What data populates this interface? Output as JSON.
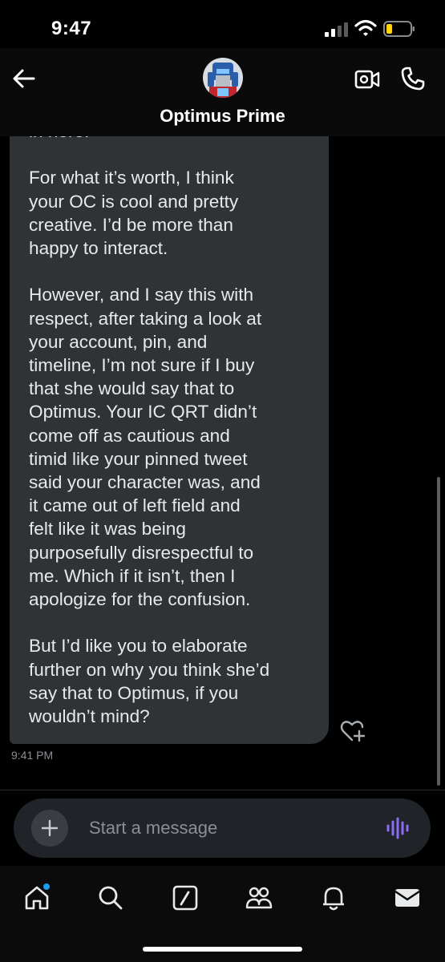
{
  "status_bar": {
    "time": "9:47"
  },
  "header": {
    "contact_name": "Optimus Prime"
  },
  "message": {
    "paragraphs": [
      [
        "in here."
      ],
      [
        "For what it’s worth, I think",
        "your OC is cool and pretty",
        "creative. I’d be more than",
        "happy to interact."
      ],
      [
        "However, and I say this with",
        "respect, after taking a look at",
        "your account, pin, and",
        "timeline, I’m not sure if I buy",
        "that she would say that to",
        "Optimus. Your IC QRT didn’t",
        "come off as cautious and",
        "timid like your pinned tweet",
        "said your character was, and",
        "it came out of left field and",
        "felt like it was being",
        "purposefully disrespectful to",
        "me. Which if it isn’t, then I",
        "apologize for the confusion."
      ],
      [
        "But I’d like you to elaborate",
        "further on why you think she’d",
        "say that to Optimus, if you",
        "wouldn’t mind?"
      ]
    ],
    "timestamp": "9:41 PM"
  },
  "composer": {
    "placeholder": "Start a message"
  },
  "tabs": [
    "home-icon",
    "search-icon",
    "grok-icon",
    "communities-icon",
    "notifications-icon",
    "messages-icon"
  ],
  "colors": {
    "bubble": "#2f3336",
    "accent_purple": "#8c6cf5",
    "notification_dot": "#1d9bf0",
    "battery_level": "#ffd60a"
  }
}
